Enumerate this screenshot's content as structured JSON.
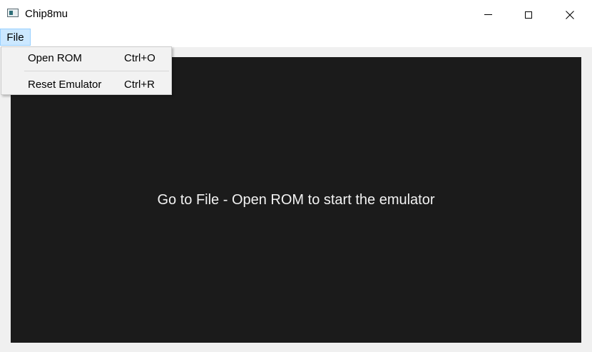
{
  "window": {
    "title": "Chip8mu"
  },
  "menubar": {
    "file_label": "File"
  },
  "file_menu": {
    "items": [
      {
        "label": "Open ROM",
        "shortcut": "Ctrl+O"
      },
      {
        "label": "Reset Emulator",
        "shortcut": "Ctrl+R"
      }
    ]
  },
  "screen": {
    "message": "Go to File - Open ROM to start the emulator"
  },
  "icons": {
    "app": "app-window-icon",
    "minimize": "minimize-icon",
    "maximize": "maximize-icon",
    "close": "close-icon"
  },
  "colors": {
    "screen_background": "#1b1b1b",
    "screen_text": "#f2f2f2",
    "menu_highlight": "#cce8ff",
    "window_background": "#f0f0f0"
  }
}
